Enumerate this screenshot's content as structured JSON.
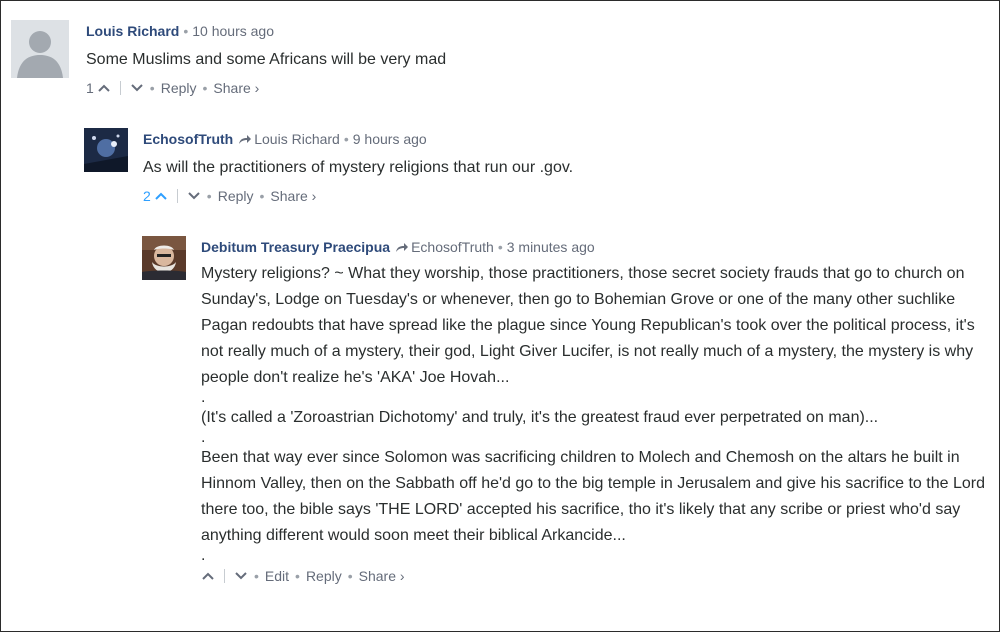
{
  "comments": [
    {
      "author": "Louis Richard",
      "parent": "",
      "time": "10 hours ago",
      "text": [
        "Some Muslims and some Africans will be very mad"
      ],
      "votes": "1",
      "actions": [
        "Reply",
        "Share ›"
      ]
    },
    {
      "author": "EchosofTruth",
      "parent": "Louis Richard",
      "time": "9 hours ago",
      "text": [
        "As will the practitioners of mystery religions that run our .gov."
      ],
      "votes": "2",
      "actions": [
        "Reply",
        "Share ›"
      ]
    },
    {
      "author": "Debitum Treasury Praecipua",
      "parent": "EchosofTruth",
      "time": "3 minutes ago",
      "text": [
        "Mystery religions? ~ What they worship, those practitioners, those secret society frauds that go to church on Sunday's, Lodge on Tuesday's or whenever, then go to Bohemian Grove or one of the many other suchlike Pagan redoubts that have spread like the plague since Young Republican's took over the political process, it's not really much of a mystery, their god, Light Giver Lucifer, is not really much of a mystery, the mystery is why people don't realize he's 'AKA' Joe Hovah...",
        ".",
        "(It's called a 'Zoroastrian Dichotomy' and truly, it's the greatest fraud ever perpetrated on man)...",
        ".",
        "Been that way ever since Solomon was sacrificing children to Molech and Chemosh on the altars he built in Hinnom Valley, then on the Sabbath off he'd go to the big temple in Jerusalem and give his sacrifice to the Lord there too, the bible says 'THE LORD' accepted his sacrifice, tho it's likely that any scribe or priest who'd say anything different would soon meet their biblical Arkancide...",
        "."
      ],
      "votes": "",
      "actions": [
        "Edit",
        "Reply",
        "Share ›"
      ]
    }
  ],
  "colors": {
    "author": "#2e4a7a",
    "meta": "#656c7a",
    "text": "#2a2e2e",
    "vote_active": "#2e9fff"
  }
}
